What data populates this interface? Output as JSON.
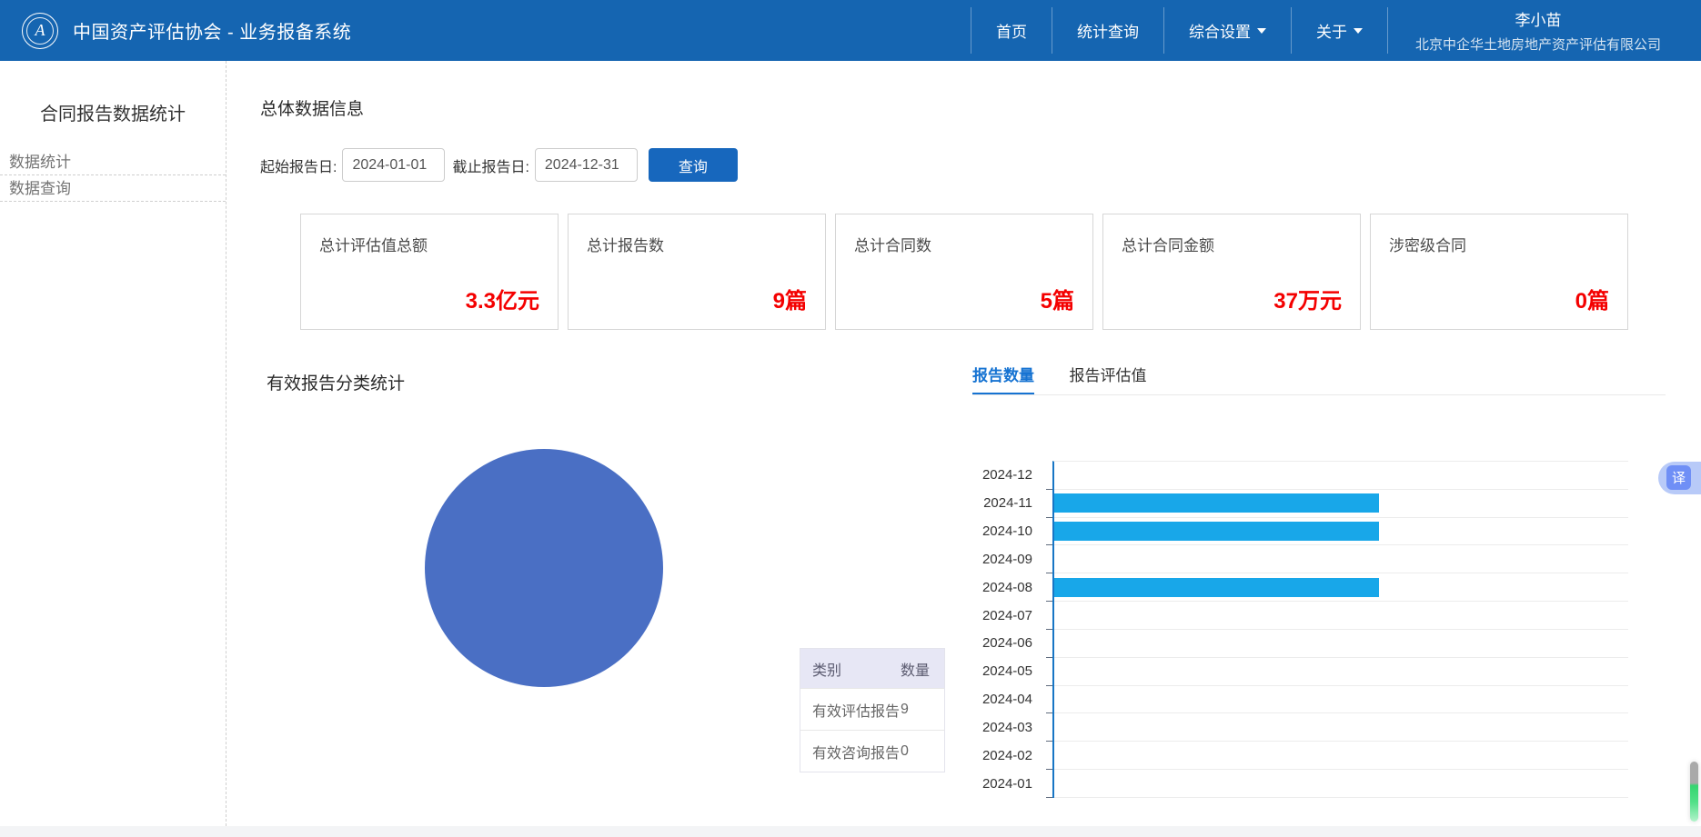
{
  "navbar": {
    "brand": "中国资产评估协会 - 业务报备系统",
    "items": [
      {
        "label": "首页"
      },
      {
        "label": "统计查询"
      },
      {
        "label": "综合设置"
      },
      {
        "label": "关于"
      }
    ],
    "user": {
      "name": "李小苗",
      "company": "北京中企华土地房地产资产评估有限公司"
    }
  },
  "sidebar": {
    "title": "合同报告数据统计",
    "items": [
      {
        "label": "数据统计"
      },
      {
        "label": "数据查询"
      }
    ]
  },
  "main": {
    "section_title": "总体数据信息",
    "filter": {
      "start_label": "起始报告日:",
      "start_value": "2024-01-01",
      "end_label": "截止报告日:",
      "end_value": "2024-12-31",
      "query_button": "查询"
    },
    "cards": [
      {
        "title": "总计评估值总额",
        "value": "3.3亿元"
      },
      {
        "title": "总计报告数",
        "value": "9篇"
      },
      {
        "title": "总计合同数",
        "value": "5篇"
      },
      {
        "title": "总计合同金额",
        "value": "37万元"
      },
      {
        "title": "涉密级合同",
        "value": "0篇"
      }
    ],
    "pie_section_title": "有效报告分类统计",
    "tabs": [
      {
        "label": "报告数量",
        "active": true
      },
      {
        "label": "报告评估值",
        "active": false
      }
    ],
    "table": {
      "headers": [
        "类别",
        "数量"
      ],
      "rows": [
        {
          "category": "有效评估报告",
          "count": "9"
        },
        {
          "category": "有效咨询报告",
          "count": "0"
        }
      ]
    }
  },
  "floating": {
    "translate_label": "译"
  },
  "colors": {
    "navbar_bg": "#1565b1",
    "button_bg": "#1767bd",
    "value_red": "#f40000",
    "tab_active": "#1673d2",
    "table_header_bg": "#e7e7f5"
  },
  "chart_data": [
    {
      "type": "pie",
      "title": "有效报告分类统计",
      "labels": [
        "有效评估报告",
        "有效咨询报告"
      ],
      "values": [
        9,
        0
      ],
      "colors": [
        "#4a6fc4"
      ],
      "legend": false
    },
    {
      "type": "bar",
      "orientation": "horizontal",
      "title": "报告数量",
      "categories": [
        "2024-12",
        "2024-11",
        "2024-10",
        "2024-09",
        "2024-08",
        "2024-07",
        "2024-06",
        "2024-05",
        "2024-04",
        "2024-03",
        "2024-02",
        "2024-01"
      ],
      "values": [
        0,
        3,
        3,
        0,
        3,
        0,
        0,
        0,
        0,
        0,
        0,
        0
      ],
      "xlabel": "",
      "ylabel": "",
      "xlim": [
        0,
        5.3
      ],
      "grid": true,
      "bar_color": "#18a7e9",
      "axis_color": "#1876c5"
    }
  ]
}
